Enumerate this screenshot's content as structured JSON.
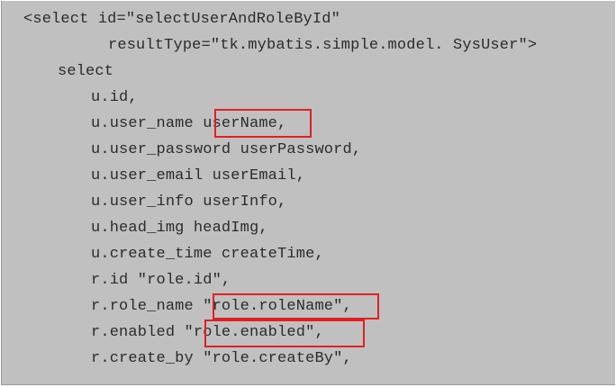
{
  "code": {
    "lines": [
      "<select id=\"selectUserAndRoleById\"",
      "resultType=\"tk.mybatis.simple.model. SysUser\">",
      "select",
      "u.id,",
      "u.user_name userName,",
      "u.user_password userPassword,",
      "u.user_email userEmail,",
      "u.user_info userInfo,",
      "u.head_img headImg,",
      "u.create_time createTime,",
      "r.id \"role.id\",",
      "r.role_name \"role.roleName\",",
      "r.enabled \"role.enabled\",",
      "r.create_by \"role.createBy\","
    ]
  },
  "highlight_color": "#e02020"
}
